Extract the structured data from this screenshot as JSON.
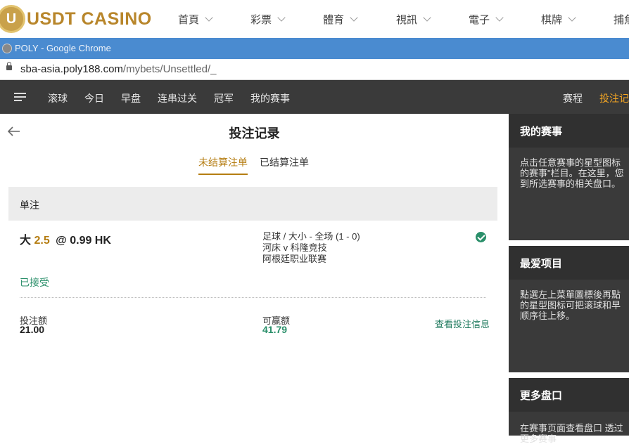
{
  "site": {
    "logo_letter": "U",
    "logo_text": "USDT CASINO",
    "nav": [
      "首頁",
      "彩票",
      "體育",
      "視訊",
      "電子",
      "棋牌",
      "捕魚"
    ]
  },
  "browser": {
    "title": "POLY - Google Chrome",
    "url_host": "sba-asia.poly188.com",
    "url_path": "/mybets/Unsettled/_"
  },
  "sportsbook_nav": {
    "items": [
      "滚球",
      "今日",
      "早盘",
      "连串过关",
      "冠军",
      "我的赛事"
    ],
    "right_items": [
      "赛程",
      "投注记录"
    ]
  },
  "page": {
    "title": "投注记录",
    "tabs": [
      "未结算注单",
      "已结算注单"
    ],
    "active_tab": "未结算注单"
  },
  "bet": {
    "type": "单注",
    "selection": "大",
    "handicap": "2.5",
    "odds": "@ 0.99 HK",
    "market": "足球 / 大小 - 全场 (1 - 0)",
    "match": "河床 v 科隆竞技",
    "league": "阿根廷职业联赛",
    "status": "已接受",
    "stake_label": "投注额",
    "stake": "21.00",
    "win_label": "可赢额",
    "win": "41.79",
    "details_link": "查看投注信息"
  },
  "side_panels": [
    {
      "title": "我的赛事",
      "lines": [
        "点击任意赛事的星型图标",
        "的赛事\"栏目。在这里，您",
        "到所选赛事的相关盘口。"
      ]
    },
    {
      "title": "最爱项目",
      "lines": [
        "點選左上菜單圖標後再點",
        "的星型图标可把滚球和早",
        "顺序往上移。"
      ]
    },
    {
      "title": "更多盘口",
      "lines": [
        "在赛事页面查看盘口 透过",
        "更多赛事"
      ]
    }
  ],
  "colors": {
    "accent_gold": "#b57d12",
    "status_green": "#2a8f6a",
    "dark_bar": "#3a3a3a",
    "chrome_blue": "#4a8bd0"
  }
}
